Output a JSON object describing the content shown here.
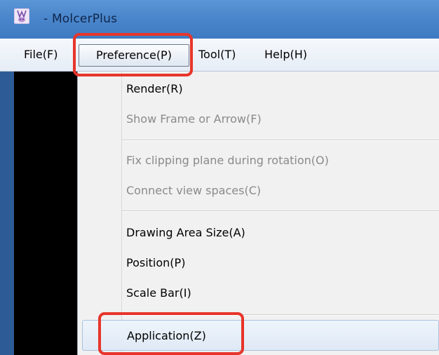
{
  "window": {
    "title": "- MolcerPlus",
    "app_icon": "molcerplus-app-icon"
  },
  "menubar": {
    "items": [
      {
        "label": "File(F)"
      },
      {
        "label": "Preference(P)",
        "state": "open"
      },
      {
        "label": "Tool(T)"
      },
      {
        "label": "Help(H)"
      }
    ]
  },
  "preference_menu": {
    "items": [
      {
        "label": "Render(R)",
        "enabled": true
      },
      {
        "label": "Show Frame or Arrow(F)",
        "enabled": false
      },
      {
        "label": "Fix clipping plane during rotation(O)",
        "enabled": false
      },
      {
        "label": "Connect view spaces(C)",
        "enabled": false
      },
      {
        "label": "Drawing Area Size(A)",
        "enabled": true
      },
      {
        "label": "Position(P)",
        "enabled": true
      },
      {
        "label": "Scale Bar(I)",
        "enabled": true
      },
      {
        "label": "Application(Z)",
        "enabled": true,
        "state": "hovered"
      }
    ]
  },
  "colors": {
    "titlebar": "#4a86cb",
    "highlight_box": "#e8352b",
    "menu_background": "#f1f1f1",
    "disabled_text": "#8a8a8a"
  }
}
